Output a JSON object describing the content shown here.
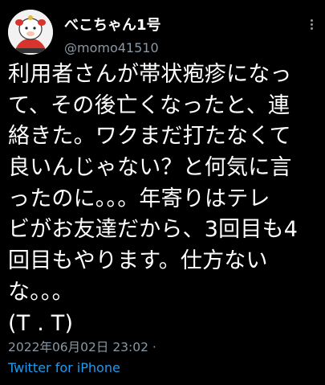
{
  "tweet": {
    "display_name": "べこちゃん1号",
    "handle": "@momo41510",
    "text_lines": [
      "利用者さんが帯状疱疹になっ",
      "て、その後亡くなったと、連",
      "絡きた。ワクまだ打たなくて",
      "良いんじゃない？と何気に言",
      "ったのに。。。年寄りはテレ",
      "ビがお友達だから、3回目も4",
      "回目もやります。仕方ない",
      "な。。。",
      "(T . T)"
    ],
    "timestamp": "2022年06月02日 23:02 ·",
    "source": "Twitter for iPhone"
  },
  "icons": {
    "avatar": "cow-mascot-avatar-icon",
    "more": "more-options-icon"
  },
  "colors": {
    "background": "#000000",
    "text": "#ffffff",
    "secondary": "#8b98a5",
    "link": "#1d9bf0"
  }
}
